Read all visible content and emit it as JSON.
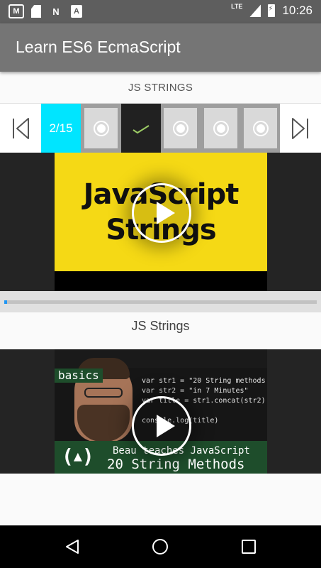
{
  "status_bar": {
    "network": "LTE",
    "time": "10:26",
    "icons": [
      "gmail-icon",
      "sd-card-icon",
      "n-icon",
      "a-icon",
      "signal-icon",
      "battery-charging-icon"
    ]
  },
  "app_bar": {
    "title": "Learn ES6 EcmaScript"
  },
  "section": {
    "title": "JS STRINGS"
  },
  "stepper": {
    "counter": "2/15",
    "current": 2,
    "total": 15,
    "prev_icon": "step-backward-icon",
    "next_icon": "step-forward-icon",
    "steps": [
      {
        "state": "pending",
        "icon": "radio-icon"
      },
      {
        "state": "done",
        "icon": "check-icon"
      },
      {
        "state": "pending",
        "icon": "radio-icon"
      },
      {
        "state": "pending",
        "icon": "radio-icon"
      },
      {
        "state": "pending",
        "icon": "radio-icon"
      }
    ],
    "accent_color": "#00e5ff"
  },
  "video1": {
    "thumb_line1": "JavaScript",
    "thumb_line2": "Strings",
    "progress": 0.01
  },
  "item": {
    "title": "JS Strings"
  },
  "video2": {
    "badge": "basics",
    "code_lines": [
      "var str1 = \"20 String methods \"",
      "var str2 = \"in 7 Minutes\"",
      "var title = str1.concat(str2)",
      "",
      "console.log(title)"
    ],
    "banner_line1": "Beau teaches JavaScript",
    "banner_line2": "20 String Methods",
    "logo_text": "( )"
  },
  "nav_bar": {
    "back_icon": "back-triangle-icon",
    "home_icon": "home-circle-icon",
    "recents_icon": "recents-square-icon"
  }
}
